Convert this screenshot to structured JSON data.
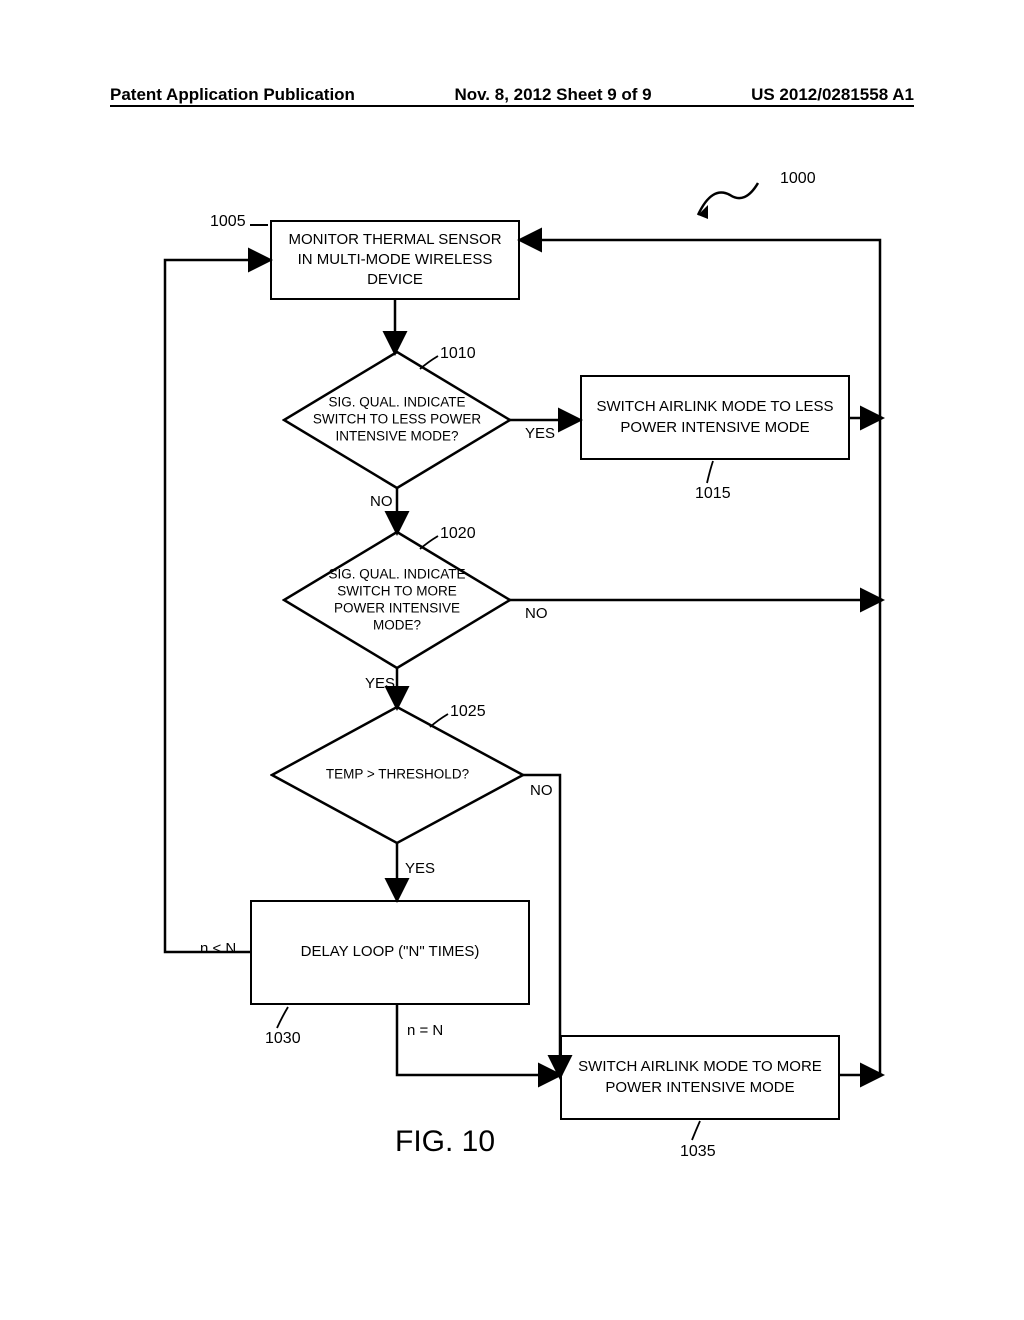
{
  "header": {
    "left": "Patent Application Publication",
    "center": "Nov. 8, 2012  Sheet 9 of 9",
    "right": "US 2012/0281558 A1"
  },
  "refs": {
    "r1000": "1000",
    "r1005": "1005",
    "r1010": "1010",
    "r1015": "1015",
    "r1020": "1020",
    "r1025": "1025",
    "r1030": "1030",
    "r1035": "1035"
  },
  "boxes": {
    "b1005": "MONITOR THERMAL SENSOR IN MULTI-MODE WIRELESS DEVICE",
    "b1015": "SWITCH  AIRLINK MODE TO LESS POWER INTENSIVE MODE",
    "b1030": "DELAY LOOP (\"N\" TIMES)",
    "b1035": "SWITCH  AIRLINK MODE TO MORE POWER INTENSIVE MODE"
  },
  "diamonds": {
    "d1010": "SIG. QUAL. INDICATE SWITCH TO LESS POWER INTENSIVE MODE?",
    "d1020": "SIG. QUAL. INDICATE SWITCH TO MORE POWER INTENSIVE MODE?",
    "d1025": "TEMP > THRESHOLD?"
  },
  "labels": {
    "yes": "YES",
    "no": "NO",
    "nlt": "n < N",
    "neq": "n = N"
  },
  "figure": "FIG.  10"
}
